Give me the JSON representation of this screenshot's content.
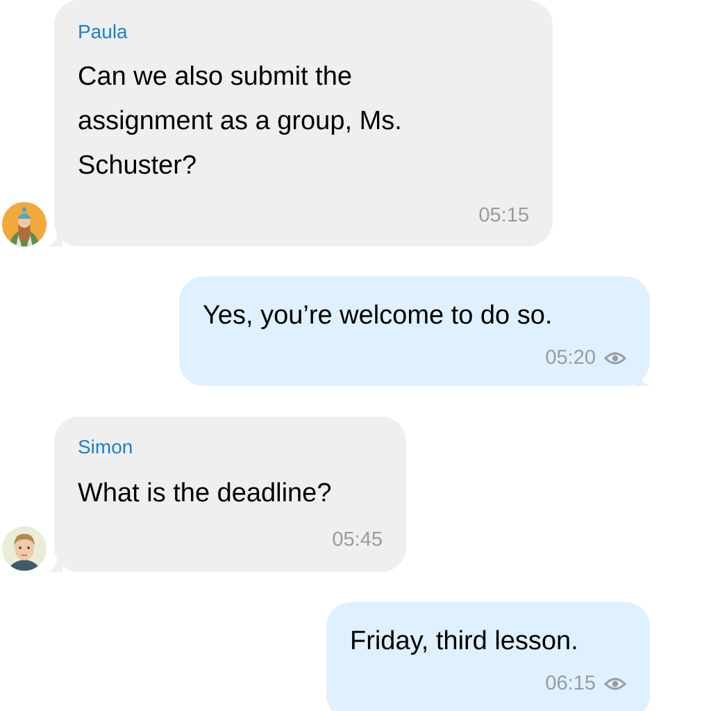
{
  "messages": [
    {
      "sender": "Paula",
      "text": "Can we also submit the\nassignment as a group, Ms.\nSchuster?",
      "time": "05:15",
      "direction": "incoming",
      "avatar": "paula-avatar"
    },
    {
      "text": "Yes, you’re welcome to do so.",
      "time": "05:20",
      "direction": "outgoing",
      "status_icon": "eye-icon"
    },
    {
      "sender": "Simon",
      "text": "What is the deadline?",
      "time": "05:45",
      "direction": "incoming",
      "avatar": "simon-avatar"
    },
    {
      "text": "Friday, third lesson.",
      "time": "06:15",
      "direction": "outgoing",
      "status_icon": "eye-icon"
    }
  ],
  "colors": {
    "incoming_bubble": "#efefef",
    "outgoing_bubble": "#dff0fe",
    "sender_name": "#1a7fd4",
    "timestamp": "#9b9b9b",
    "message_text": "#000000"
  }
}
